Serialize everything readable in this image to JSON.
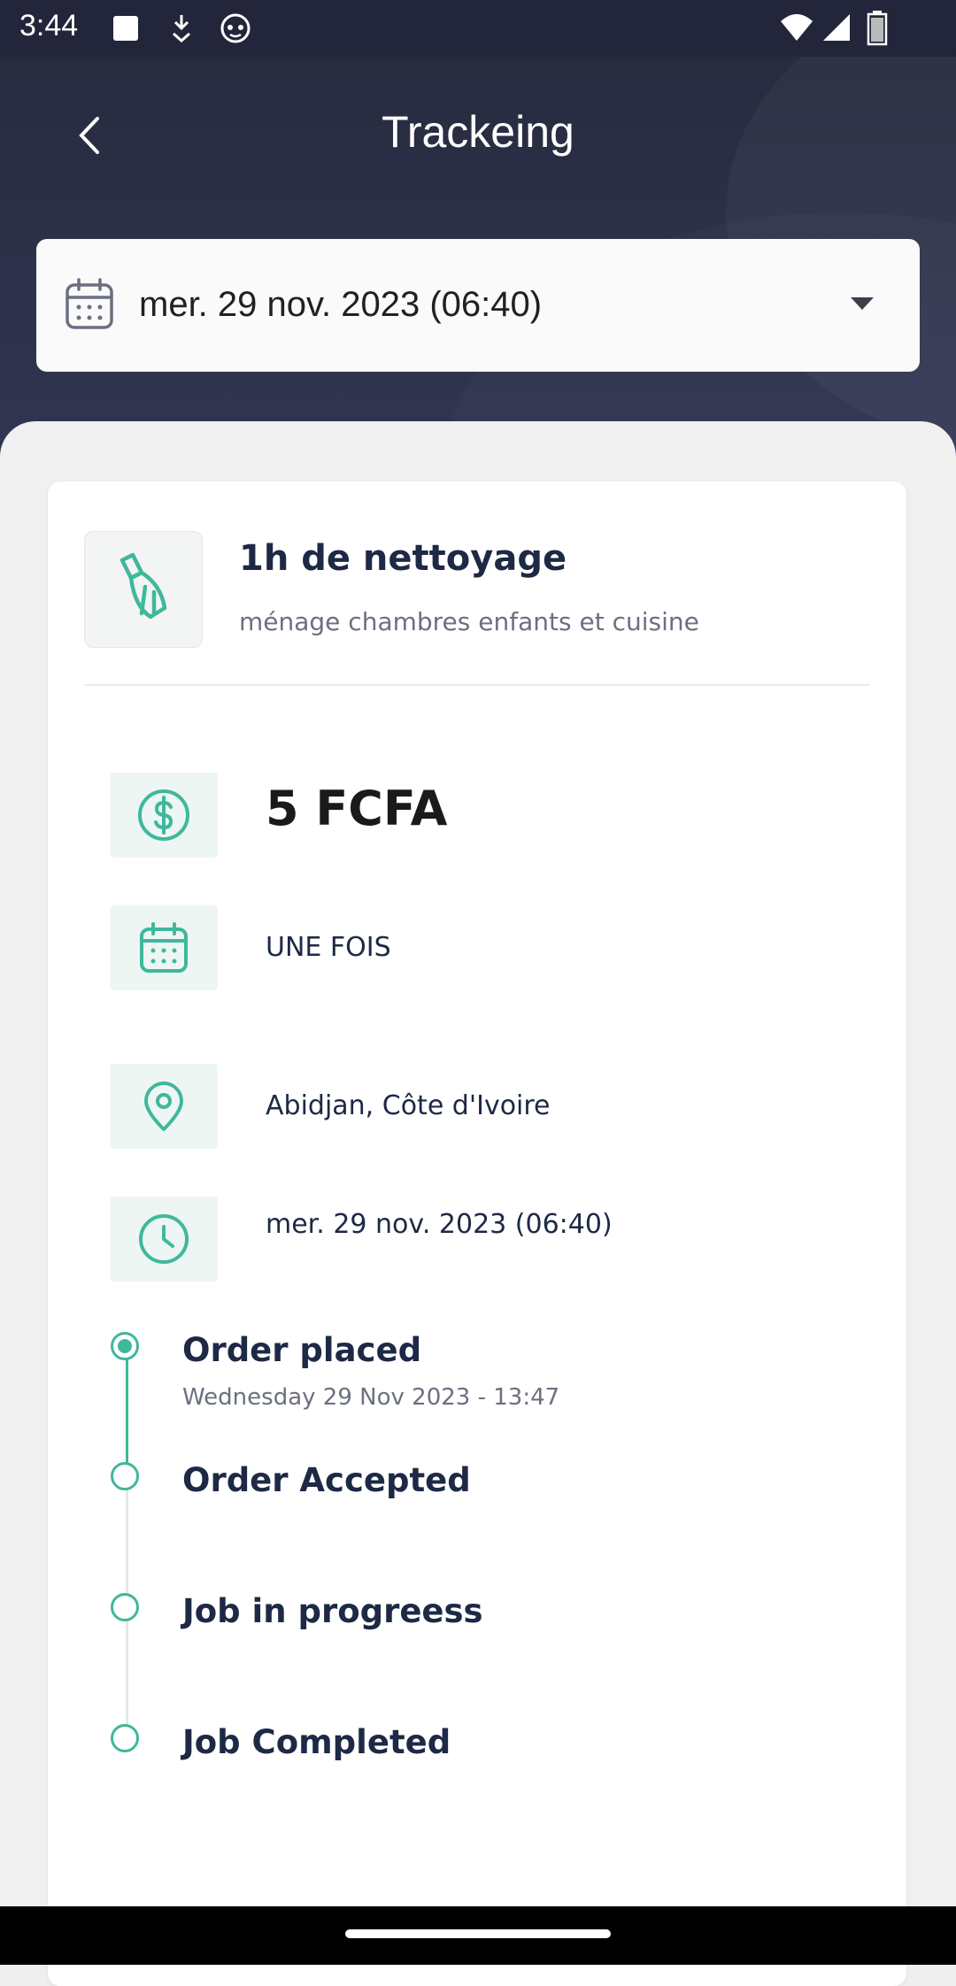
{
  "status_bar": {
    "time": "3:44",
    "icons": [
      "square-icon",
      "download-icon",
      "cat-face-icon",
      "wifi-icon",
      "signal-icon",
      "battery-icon"
    ]
  },
  "header": {
    "title": "Trackeing",
    "back_icon": "back-chevron-icon"
  },
  "date_select": {
    "value": "mer. 29 nov. 2023 (06:40)",
    "icon": "calendar-icon",
    "caret_icon": "caret-down-icon"
  },
  "service": {
    "icon": "broom-icon",
    "title": "1h de nettoyage",
    "subtitle": "ménage chambres enfants et cuisine"
  },
  "details": {
    "price": "5 FCFA",
    "frequency": "UNE FOIS",
    "location": "Abidjan, Côte d'Ivoire",
    "datetime": "mer. 29 nov. 2023 (06:40)"
  },
  "timeline": [
    {
      "label": "Order placed",
      "date": "Wednesday 29 Nov 2023 - 13:47",
      "done": true
    },
    {
      "label": "Order Accepted",
      "date": "",
      "done": false
    },
    {
      "label": "Job in progreess",
      "date": "",
      "done": false
    },
    {
      "label": "Job Completed",
      "date": "",
      "done": false
    }
  ],
  "colors": {
    "accent": "#3fb89b",
    "header_bg": "#2d3149",
    "text_dark": "#1d2945"
  }
}
